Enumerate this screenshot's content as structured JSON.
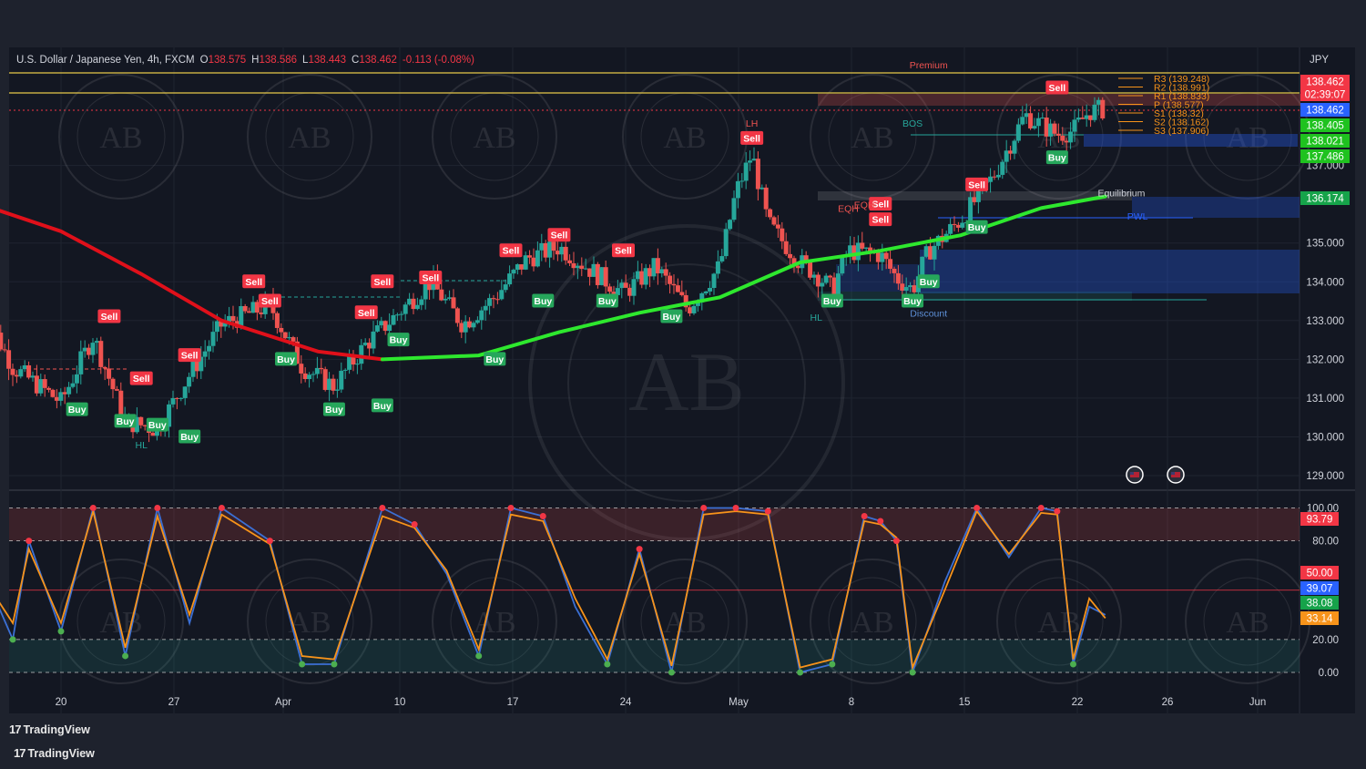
{
  "header": {
    "symbol": "U.S. Dollar / Japanese Yen, 4h, FXCM",
    "o_label": "O",
    "o": "138.575",
    "h_label": "H",
    "h": "138.586",
    "l_label": "L",
    "l": "138.443",
    "c_label": "C",
    "c": "138.462",
    "change": "-0.113 (-0.08%)"
  },
  "currency": "JPY",
  "brand": {
    "logo": "17",
    "name": "TradingView"
  },
  "colors": {
    "background": "#131722",
    "frame": "#1e222d",
    "bull": "#26a69a",
    "bear": "#ef5350",
    "sell_label": "#f23645",
    "buy_label": "#26a65b",
    "ema_red": "#e0101a",
    "ema_green": "#2ee82e",
    "k_line": "#3b6fd4",
    "d_line": "#f7931a"
  },
  "chart_data": [
    {
      "type": "candlestick",
      "title": "U.S. Dollar / Japanese Yen, 4h, FXCM",
      "x_tick_labels": [
        "20",
        "27",
        "Apr",
        "10",
        "17",
        "24",
        "May",
        "8",
        "15",
        "22",
        "26",
        "Jun"
      ],
      "y_ticks": [
        129.0,
        130.0,
        131.0,
        132.0,
        133.0,
        134.0,
        135.0,
        137.0
      ],
      "y_tick_labels": [
        "129.000",
        "130.000",
        "131.000",
        "132.000",
        "133.000",
        "134.000",
        "135.000",
        "137.000"
      ],
      "ylim": [
        128.6,
        139.8
      ],
      "grid": true,
      "price_path": [
        [
          "2023-03-15",
          133.4
        ],
        [
          "2023-03-17",
          131.8
        ],
        [
          "2023-03-20",
          130.9
        ],
        [
          "2023-03-22",
          132.6
        ],
        [
          "2023-03-24",
          130.4
        ],
        [
          "2023-03-26",
          130.2
        ],
        [
          "2023-03-28",
          131.6
        ],
        [
          "2023-03-30",
          132.9
        ],
        [
          "2023-04-02",
          133.4
        ],
        [
          "2023-04-04",
          131.8
        ],
        [
          "2023-04-06",
          131.3
        ],
        [
          "2023-04-08",
          132.4
        ],
        [
          "2023-04-10",
          133.2
        ],
        [
          "2023-04-12",
          134.0
        ],
        [
          "2023-04-14",
          132.9
        ],
        [
          "2023-04-16",
          133.6
        ],
        [
          "2023-04-18",
          134.6
        ],
        [
          "2023-04-20",
          134.9
        ],
        [
          "2023-04-22",
          134.3
        ],
        [
          "2023-04-24",
          133.7
        ],
        [
          "2023-04-26",
          134.4
        ],
        [
          "2023-04-28",
          133.3
        ],
        [
          "2023-04-30",
          134.4
        ],
        [
          "2023-05-01",
          136.3
        ],
        [
          "2023-05-02",
          137.3
        ],
        [
          "2023-05-03",
          135.5
        ],
        [
          "2023-05-05",
          134.5
        ],
        [
          "2023-05-06",
          134.2
        ],
        [
          "2023-05-07",
          133.8
        ],
        [
          "2023-05-08",
          134.8
        ],
        [
          "2023-05-10",
          134.7
        ],
        [
          "2023-05-11",
          134.1
        ],
        [
          "2023-05-12",
          133.8
        ],
        [
          "2023-05-13",
          134.8
        ],
        [
          "2023-05-15",
          135.6
        ],
        [
          "2023-05-17",
          136.7
        ],
        [
          "2023-05-19",
          138.3
        ],
        [
          "2023-05-21",
          137.8
        ],
        [
          "2023-05-22",
          137.9
        ],
        [
          "2023-05-23",
          138.4
        ],
        [
          "2023-05-24",
          138.46
        ]
      ],
      "series": [
        {
          "name": "",
          "color": "#e0101a",
          "values": [
            [
              "2023-03-15",
              136.0
            ],
            [
              "2023-03-20",
              135.3
            ],
            [
              "2023-03-25",
              134.2
            ],
            [
              "2023-03-30",
              133.0
            ],
            [
              "2023-04-05",
              132.2
            ],
            [
              "2023-04-09",
              132.0
            ]
          ]
        },
        {
          "name": "",
          "color": "#2ee82e",
          "values": [
            [
              "2023-04-09",
              132.0
            ],
            [
              "2023-04-15",
              132.1
            ],
            [
              "2023-04-20",
              132.7
            ],
            [
              "2023-04-25",
              133.2
            ],
            [
              "2023-04-30",
              133.6
            ],
            [
              "2023-05-05",
              134.5
            ],
            [
              "2023-05-10",
              134.8
            ],
            [
              "2023-05-15",
              135.2
            ],
            [
              "2023-05-20",
              135.9
            ],
            [
              "2023-05-24",
              136.2
            ]
          ]
        }
      ],
      "signals": [
        {
          "type": "Buy",
          "date": "2023-03-21",
          "price": 130.7
        },
        {
          "type": "Sell",
          "date": "2023-03-23",
          "price": 133.1
        },
        {
          "type": "Buy",
          "date": "2023-03-24",
          "price": 130.4
        },
        {
          "type": "Sell",
          "date": "2023-03-25",
          "price": 131.5
        },
        {
          "type": "Buy",
          "date": "2023-03-26",
          "price": 130.3
        },
        {
          "type": "Sell",
          "date": "2023-03-28",
          "price": 132.1
        },
        {
          "type": "Buy",
          "date": "2023-03-28",
          "price": 130.0
        },
        {
          "type": "Sell",
          "date": "2023-04-01",
          "price": 134.0
        },
        {
          "type": "Sell",
          "date": "2023-04-02",
          "price": 133.5
        },
        {
          "type": "Buy",
          "date": "2023-04-03",
          "price": 132.0
        },
        {
          "type": "Buy",
          "date": "2023-04-06",
          "price": 130.7
        },
        {
          "type": "Sell",
          "date": "2023-04-08",
          "price": 133.2
        },
        {
          "type": "Buy",
          "date": "2023-04-09",
          "price": 130.8
        },
        {
          "type": "Sell",
          "date": "2023-04-09",
          "price": 134.0
        },
        {
          "type": "Buy",
          "date": "2023-04-10",
          "price": 132.5
        },
        {
          "type": "Sell",
          "date": "2023-04-12",
          "price": 134.1
        },
        {
          "type": "Buy",
          "date": "2023-04-16",
          "price": 132.0
        },
        {
          "type": "Sell",
          "date": "2023-04-17",
          "price": 134.8
        },
        {
          "type": "Buy",
          "date": "2023-04-19",
          "price": 133.5
        },
        {
          "type": "Sell",
          "date": "2023-04-20",
          "price": 135.2
        },
        {
          "type": "Buy",
          "date": "2023-04-23",
          "price": 133.5
        },
        {
          "type": "Sell",
          "date": "2023-04-24",
          "price": 134.8
        },
        {
          "type": "Buy",
          "date": "2023-04-27",
          "price": 133.1
        },
        {
          "type": "Sell",
          "date": "2023-05-02",
          "price": 137.7
        },
        {
          "type": "Buy",
          "date": "2023-05-07",
          "price": 133.5
        },
        {
          "type": "Sell",
          "date": "2023-05-10",
          "price": 135.6
        },
        {
          "type": "Sell",
          "date": "2023-05-10",
          "price": 136.0
        },
        {
          "type": "Buy",
          "date": "2023-05-12",
          "price": 133.5
        },
        {
          "type": "Buy",
          "date": "2023-05-13",
          "price": 134.0
        },
        {
          "type": "Sell",
          "date": "2023-05-16",
          "price": 136.5
        },
        {
          "type": "Buy",
          "date": "2023-05-16",
          "price": 135.4
        },
        {
          "type": "Sell",
          "date": "2023-05-21",
          "price": 139.0
        },
        {
          "type": "Buy",
          "date": "2023-05-21",
          "price": 137.2
        }
      ],
      "structure_labels": [
        {
          "text": "HL",
          "date": "2023-03-25",
          "price": 129.7,
          "color": "#26a69a"
        },
        {
          "text": "LH",
          "date": "2023-05-02",
          "price": 138.0,
          "color": "#ef5350"
        },
        {
          "text": "BOS",
          "date": "2023-05-12",
          "price": 138.0,
          "color": "#26a69a"
        },
        {
          "text": "EQH",
          "date": "2023-05-08",
          "price": 135.8,
          "color": "#ef5350"
        },
        {
          "text": "EQH",
          "date": "2023-05-09",
          "price": 135.9,
          "color": "#ef5350"
        },
        {
          "text": "HL",
          "date": "2023-05-06",
          "price": 133.0,
          "color": "#26a69a"
        },
        {
          "text": "Premium",
          "date": "2023-05-13",
          "price": 139.5,
          "color": "#ef5350"
        },
        {
          "text": "Discount",
          "date": "2023-05-13",
          "price": 133.1,
          "color": "#5d8fd6"
        },
        {
          "text": "Equilibrium",
          "date": "2023-05-25",
          "price": 136.2,
          "color": "#d1d4dc"
        },
        {
          "text": "PWL",
          "date": "2023-05-26",
          "price": 135.6,
          "color": "#2962ff"
        }
      ],
      "pivot_levels": [
        {
          "label": "R3 (139.248)",
          "price": 139.248,
          "color": "#f7931a"
        },
        {
          "label": "R2 (138.991)",
          "price": 138.991,
          "color": "#f7931a"
        },
        {
          "label": "R1 (138.833)",
          "price": 138.833,
          "color": "#f7931a"
        },
        {
          "label": "P (138.577)",
          "price": 138.577,
          "color": "#f7931a"
        },
        {
          "label": "S1 (138.32)",
          "price": 138.32,
          "color": "#f7931a"
        },
        {
          "label": "S2 (138.162)",
          "price": 138.162,
          "color": "#f7931a"
        },
        {
          "label": "S3 (137.906)",
          "price": 137.906,
          "color": "#f7931a"
        }
      ],
      "price_tags": [
        {
          "text": "138.462",
          "color": "#f23645"
        },
        {
          "text": "02:39:07",
          "color": "#f23645"
        },
        {
          "text": "138.462",
          "color": "#2962ff"
        },
        {
          "text": "138.405",
          "color": "#1fc21f"
        },
        {
          "text": "138.021",
          "color": "#1fc21f"
        },
        {
          "text": "137.486",
          "color": "#1fc21f"
        },
        {
          "text": "136.174",
          "color": "#16a34a"
        }
      ]
    },
    {
      "type": "line",
      "title": "",
      "y_ticks": [
        0,
        20,
        80,
        100
      ],
      "y_tick_labels": [
        "0.00",
        "20.00",
        "80.00",
        "100.00"
      ],
      "ylim": [
        -3,
        103
      ],
      "grid": true,
      "series": [
        {
          "name": "",
          "color": "#3b6fd4",
          "values": [
            [
              "2023-03-15",
              65
            ],
            [
              "2023-03-17",
              20
            ],
            [
              "2023-03-18",
              80
            ],
            [
              "2023-03-20",
              25
            ],
            [
              "2023-03-22",
              100
            ],
            [
              "2023-03-24",
              10
            ],
            [
              "2023-03-26",
              100
            ],
            [
              "2023-03-28",
              30
            ],
            [
              "2023-03-30",
              100
            ],
            [
              "2023-04-02",
              80
            ],
            [
              "2023-04-04",
              5
            ],
            [
              "2023-04-06",
              5
            ],
            [
              "2023-04-09",
              100
            ],
            [
              "2023-04-11",
              90
            ],
            [
              "2023-04-13",
              60
            ],
            [
              "2023-04-15",
              10
            ],
            [
              "2023-04-17",
              100
            ],
            [
              "2023-04-19",
              95
            ],
            [
              "2023-04-21",
              40
            ],
            [
              "2023-04-23",
              5
            ],
            [
              "2023-04-25",
              75
            ],
            [
              "2023-04-27",
              0
            ],
            [
              "2023-04-29",
              100
            ],
            [
              "2023-05-01",
              100
            ],
            [
              "2023-05-03",
              98
            ],
            [
              "2023-05-05",
              0
            ],
            [
              "2023-05-07",
              5
            ],
            [
              "2023-05-09",
              95
            ],
            [
              "2023-05-10",
              92
            ],
            [
              "2023-05-11",
              80
            ],
            [
              "2023-05-12",
              0
            ],
            [
              "2023-05-14",
              55
            ],
            [
              "2023-05-16",
              100
            ],
            [
              "2023-05-18",
              70
            ],
            [
              "2023-05-20",
              100
            ],
            [
              "2023-05-21",
              98
            ],
            [
              "2023-05-22",
              5
            ],
            [
              "2023-05-23",
              40
            ],
            [
              "2023-05-24",
              35
            ]
          ]
        },
        {
          "name": "",
          "color": "#f7931a",
          "values": [
            [
              "2023-03-15",
              60
            ],
            [
              "2023-03-17",
              30
            ],
            [
              "2023-03-18",
              75
            ],
            [
              "2023-03-20",
              30
            ],
            [
              "2023-03-22",
              98
            ],
            [
              "2023-03-24",
              15
            ],
            [
              "2023-03-26",
              95
            ],
            [
              "2023-03-28",
              35
            ],
            [
              "2023-03-30",
              96
            ],
            [
              "2023-04-02",
              78
            ],
            [
              "2023-04-04",
              10
            ],
            [
              "2023-04-06",
              8
            ],
            [
              "2023-04-09",
              95
            ],
            [
              "2023-04-11",
              88
            ],
            [
              "2023-04-13",
              62
            ],
            [
              "2023-04-15",
              14
            ],
            [
              "2023-04-17",
              96
            ],
            [
              "2023-04-19",
              92
            ],
            [
              "2023-04-21",
              45
            ],
            [
              "2023-04-23",
              8
            ],
            [
              "2023-04-25",
              72
            ],
            [
              "2023-04-27",
              4
            ],
            [
              "2023-04-29",
              96
            ],
            [
              "2023-05-01",
              98
            ],
            [
              "2023-05-03",
              96
            ],
            [
              "2023-05-05",
              3
            ],
            [
              "2023-05-07",
              8
            ],
            [
              "2023-05-09",
              92
            ],
            [
              "2023-05-10",
              90
            ],
            [
              "2023-05-11",
              82
            ],
            [
              "2023-05-12",
              3
            ],
            [
              "2023-05-14",
              50
            ],
            [
              "2023-05-16",
              98
            ],
            [
              "2023-05-18",
              72
            ],
            [
              "2023-05-20",
              97
            ],
            [
              "2023-05-21",
              96
            ],
            [
              "2023-05-22",
              8
            ],
            [
              "2023-05-23",
              45
            ],
            [
              "2023-05-24",
              33
            ]
          ]
        }
      ],
      "value_tags": [
        {
          "text": "93.79",
          "color": "#f23645"
        },
        {
          "text": "50.00",
          "color": "#f23645"
        },
        {
          "text": "39.07",
          "color": "#2962ff"
        },
        {
          "text": "38.08",
          "color": "#16a34a"
        },
        {
          "text": "33.14",
          "color": "#f7931a"
        }
      ]
    }
  ]
}
